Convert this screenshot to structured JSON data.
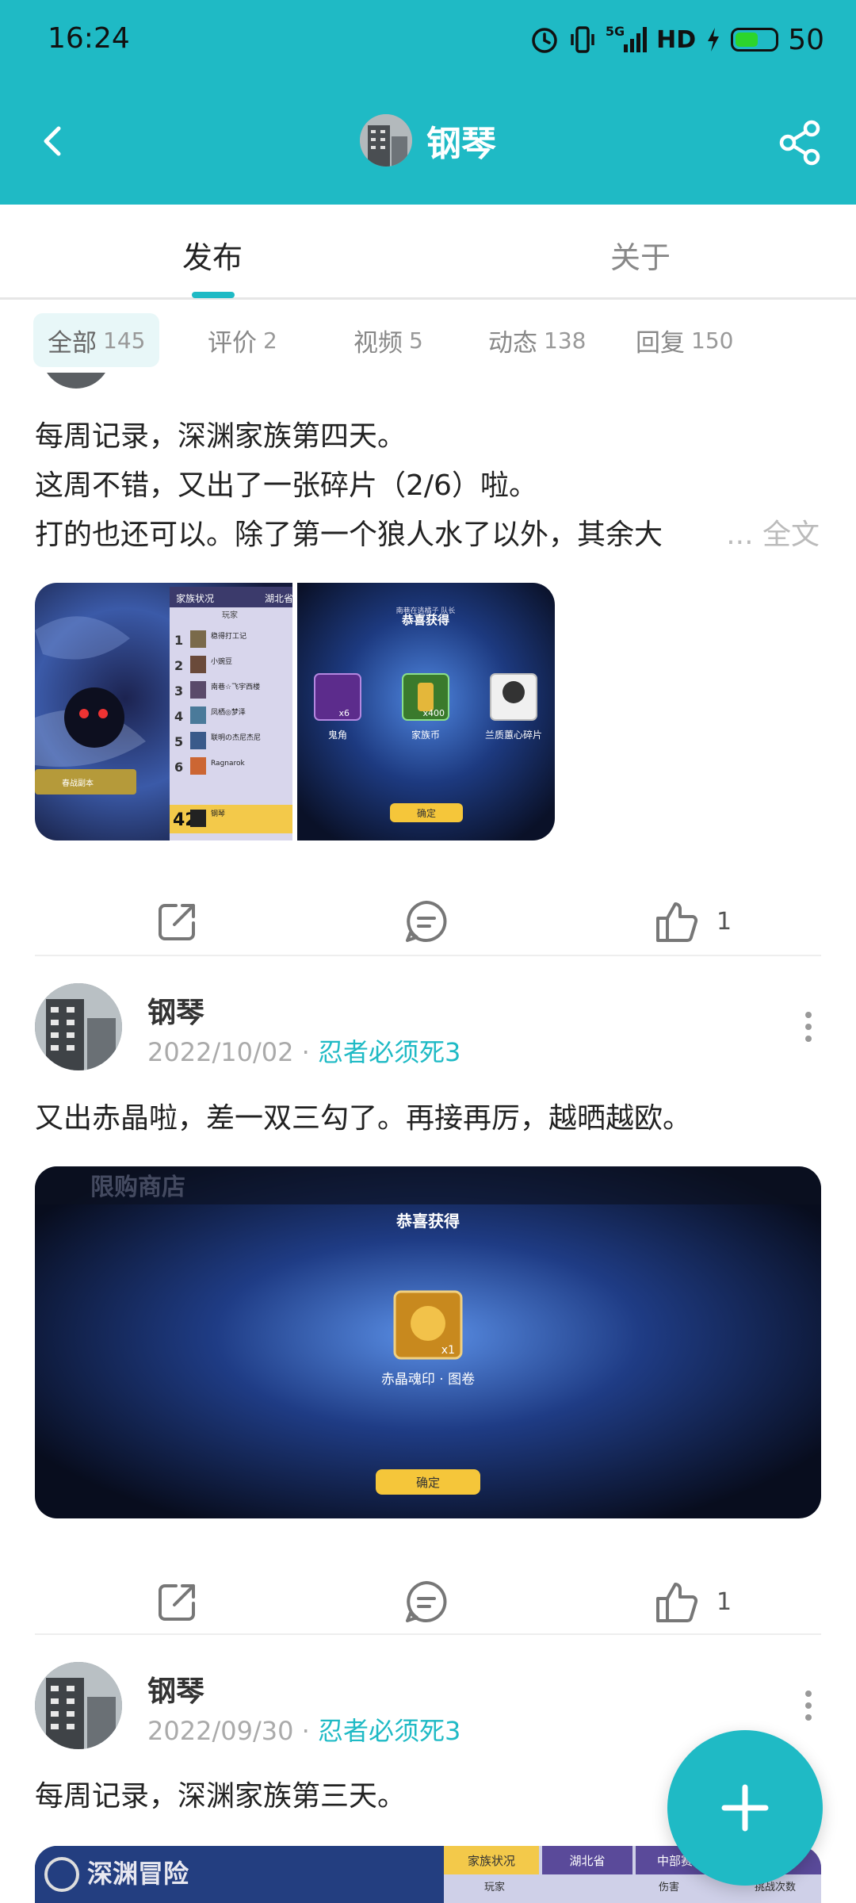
{
  "status_bar": {
    "time": "16:24",
    "network": "5G",
    "hd": "HD",
    "battery": "50"
  },
  "toolbar": {
    "title": "钢琴",
    "back_icon": "chevron-left-icon",
    "share_icon": "share-icon"
  },
  "main_tabs": [
    {
      "label": "发布",
      "active": true
    },
    {
      "label": "关于",
      "active": false
    }
  ],
  "filters": [
    {
      "label": "全部",
      "count": "145",
      "active": true
    },
    {
      "label": "评价",
      "count": "2",
      "active": false
    },
    {
      "label": "视频",
      "count": "5",
      "active": false
    },
    {
      "label": "动态",
      "count": "138",
      "active": false
    },
    {
      "label": "回复",
      "count": "150",
      "active": false
    }
  ],
  "posts": [
    {
      "text_lines": [
        "每周记录，深渊家族第四天。",
        "这周不错，又出了一张碎片（2/6）啦。",
        "打的也还可以。除了第一个狼人水了以外，其余大"
      ],
      "more_label": "... 全文",
      "images": [
        {
          "tabs": [
            "家族状况",
            "湖北省"
          ],
          "subtab": "玩家",
          "ranks": [
            "1",
            "2",
            "3",
            "4",
            "5",
            "6",
            "42"
          ],
          "names": [
            "稳得打工记",
            "小豌豆",
            "南巷☆飞宇西楼",
            "凤栖◎梦泽",
            "联明の杰尼杰尼",
            "Ragnarok",
            "钢琴"
          ],
          "badge": "春战副本"
        },
        {
          "title": "恭喜获得",
          "items": [
            "鬼角",
            "家族币",
            "兰质蕙心碎片"
          ],
          "qty": [
            "x6",
            "x400",
            ""
          ],
          "button": "确定",
          "ticker": "南巷在逃橘子 队长"
        }
      ],
      "likes": "1"
    },
    {
      "author": "钢琴",
      "date": "2022/10/02",
      "game": "忍者必须死3",
      "text": "又出赤晶啦，差一双三勾了。再接再厉，越晒越欧。",
      "image": {
        "header": "限购商店",
        "title": "恭喜获得",
        "item": "赤晶魂印 · 图卷",
        "qty": "x1",
        "button": "确定"
      },
      "likes": "1"
    },
    {
      "author": "钢琴",
      "date": "2022/09/30",
      "game": "忍者必须死3",
      "text": "每周记录，深渊家族第三天。",
      "image": {
        "header": "深渊冒险",
        "tabs": [
          "家族状况",
          "湖北省",
          "中部赛区",
          "全国"
        ],
        "cols": [
          "玩家",
          "伤害",
          "挑战次数"
        ]
      }
    }
  ],
  "fab_icon": "plus-icon",
  "colors": {
    "accent": "#1fbac5",
    "header_bg": "#1fbac5"
  }
}
